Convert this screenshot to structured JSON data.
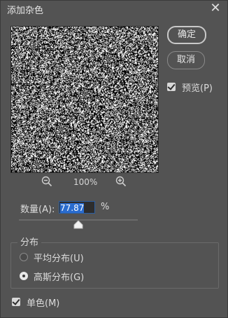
{
  "window": {
    "title": "添加杂色",
    "close_icon": "close-icon"
  },
  "buttons": {
    "ok": "确定",
    "cancel": "取消"
  },
  "preview": {
    "label": "预览(P)",
    "checked": true
  },
  "zoom": {
    "level": "100%",
    "zoom_out_icon": "zoom-out-icon",
    "zoom_in_icon": "zoom-in-icon"
  },
  "amount": {
    "label": "数量(A):",
    "value": "77.87",
    "unit": "%",
    "slider_fraction": 0.5
  },
  "distribution": {
    "title": "分布",
    "options": [
      {
        "label": "平均分布(U)",
        "selected": false
      },
      {
        "label": "高斯分布(G)",
        "selected": true
      }
    ]
  },
  "monochromatic": {
    "label": "单色(M)",
    "checked": true
  },
  "colors": {
    "background": "#535353",
    "accent": "#2a6ccf"
  }
}
